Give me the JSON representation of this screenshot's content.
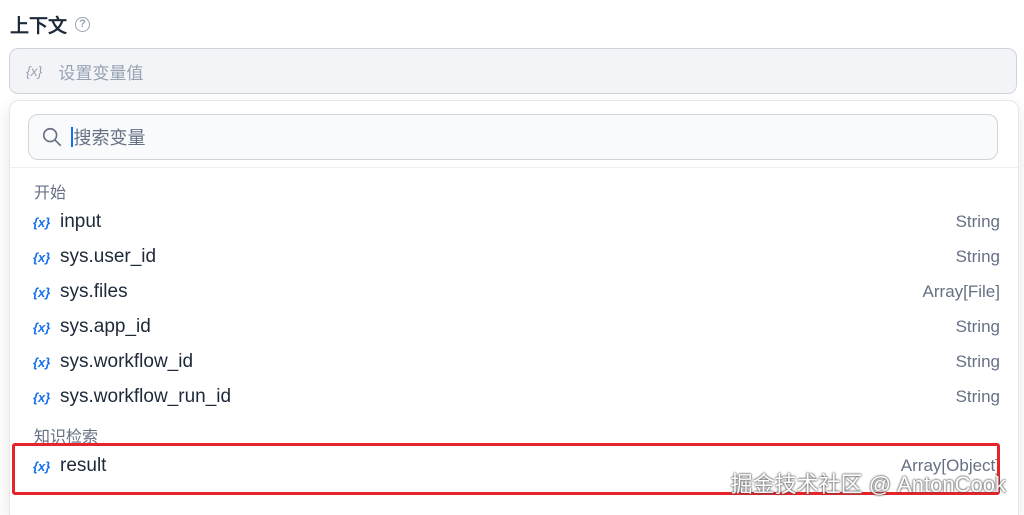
{
  "section": {
    "title": "上下文",
    "help_icon": "help-icon"
  },
  "variable_input": {
    "icon": "{x}",
    "placeholder": "设置变量值"
  },
  "dropdown": {
    "search_placeholder": "搜索变量",
    "groups": [
      {
        "label": "开始",
        "items": [
          {
            "icon": "{x}",
            "name": "input",
            "type": "String"
          },
          {
            "icon": "{x}",
            "name": "sys.user_id",
            "type": "String"
          },
          {
            "icon": "{x}",
            "name": "sys.files",
            "type": "Array[File]"
          },
          {
            "icon": "{x}",
            "name": "sys.app_id",
            "type": "String"
          },
          {
            "icon": "{x}",
            "name": "sys.workflow_id",
            "type": "String"
          },
          {
            "icon": "{x}",
            "name": "sys.workflow_run_id",
            "type": "String"
          }
        ]
      },
      {
        "label": "知识检索",
        "items": [
          {
            "icon": "{x}",
            "name": "result",
            "type": "Array[Object]"
          }
        ]
      }
    ]
  },
  "colors": {
    "accent": "#1570ef",
    "highlight": "#e5252a"
  },
  "watermark": "掘金技术社区 @ AntonCook"
}
